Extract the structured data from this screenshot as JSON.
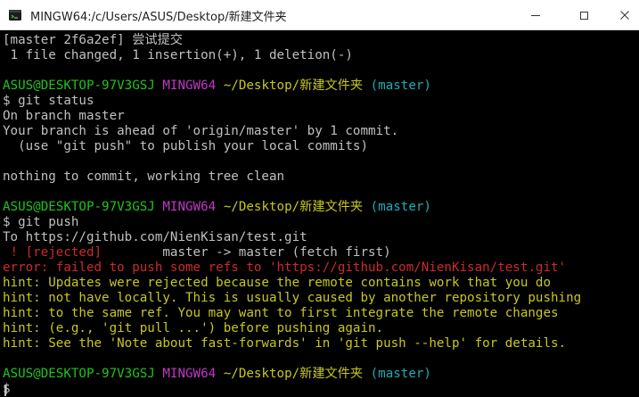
{
  "window": {
    "title": "MINGW64:/c/Users/ASUS/Desktop/新建文件夹"
  },
  "terminal": {
    "lines": [
      {
        "id": "l1",
        "text": "[master 2f6a2ef] 尝试提交"
      },
      {
        "id": "l2",
        "text": " 1 file changed, 1 insertion(+), 1 deletion(-)"
      },
      {
        "id": "l3",
        "parts": {
          "user": "ASUS@DESKTOP-97V3GSJ",
          "env": "MINGW64",
          "path": "~/Desktop/新建文件夹",
          "branch": "(master)"
        }
      },
      {
        "id": "l4",
        "text": "$ git status"
      },
      {
        "id": "l5",
        "text": "On branch master"
      },
      {
        "id": "l6",
        "text": "Your branch is ahead of 'origin/master' by 1 commit."
      },
      {
        "id": "l7",
        "text": "  (use \"git push\" to publish your local commits)"
      },
      {
        "id": "l8",
        "text": "nothing to commit, working tree clean"
      },
      {
        "id": "l9",
        "parts": {
          "user": "ASUS@DESKTOP-97V3GSJ",
          "env": "MINGW64",
          "path": "~/Desktop/新建文件夹",
          "branch": "(master)"
        }
      },
      {
        "id": "l10",
        "text": "$ git push"
      },
      {
        "id": "l11",
        "text": "To https://github.com/NienKisan/test.git"
      },
      {
        "id": "l12",
        "parts": {
          "rejected": " ! [rejected]",
          "rest": "        master -> master (fetch first)"
        }
      },
      {
        "id": "l13",
        "text": "error: failed to push some refs to 'https://github.com/NienKisan/test.git'"
      },
      {
        "id": "l14",
        "text": "hint: Updates were rejected because the remote contains work that you do"
      },
      {
        "id": "l15",
        "text": "hint: not have locally. This is usually caused by another repository pushing"
      },
      {
        "id": "l16",
        "text": "hint: to the same ref. You may want to first integrate the remote changes"
      },
      {
        "id": "l17",
        "text": "hint: (e.g., 'git pull ...') before pushing again."
      },
      {
        "id": "l18",
        "text": "hint: See the 'Note about fast-forwards' in 'git push --help' for details."
      },
      {
        "id": "l19",
        "parts": {
          "user": "ASUS@DESKTOP-97V3GSJ",
          "env": "MINGW64",
          "path": "~/Desktop/新建文件夹",
          "branch": "(master)"
        }
      },
      {
        "id": "l20",
        "text": "$ "
      }
    ]
  },
  "colors": {
    "background": "#000000",
    "default_text": "#c0c0c0",
    "user_host": "#1ec51e",
    "env": "#c337c8",
    "path": "#c7c71f",
    "branch": "#1aaeb6",
    "error": "#cc2a2a",
    "hint": "#c7c71f"
  },
  "icons": {
    "app": "git-bash-icon",
    "minimize": "minimize-icon",
    "maximize": "maximize-icon",
    "close": "close-icon"
  }
}
